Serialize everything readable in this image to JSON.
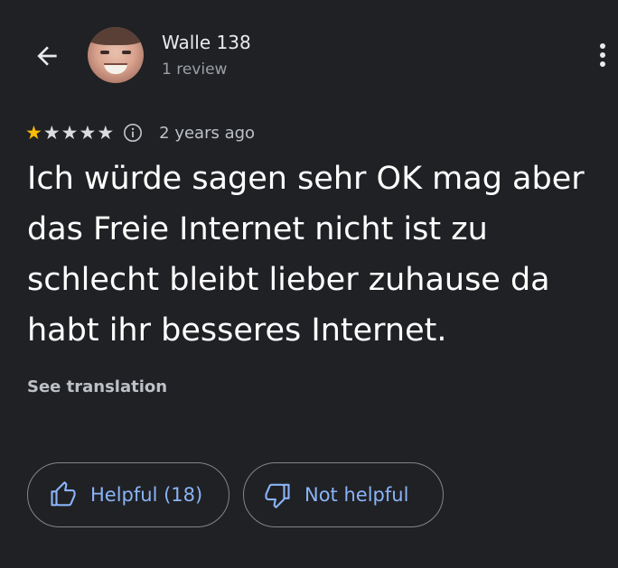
{
  "reviewer": {
    "name": "Walle 138",
    "review_count": "1 review"
  },
  "icons": {
    "back": "arrow-left-icon",
    "more": "more-vert-icon",
    "info": "info-icon",
    "thumb_up": "thumb-up-icon",
    "thumb_down": "thumb-down-icon"
  },
  "review": {
    "rating": 1,
    "max_rating": 5,
    "date": "2 years ago",
    "text": "Ich würde sagen sehr OK mag aber das Freie Internet nicht ist zu schlecht bleibt lieber zuhause da habt ihr besseres Internet.",
    "see_translation": "See translation"
  },
  "actions": {
    "helpful_label": "Helpful (18)",
    "not_helpful_label": "Not helpful"
  },
  "colors": {
    "background": "#202124",
    "star_filled": "#fbbc04",
    "star_empty": "#dadce0",
    "accent": "#8ab4f8",
    "outline": "#80868b"
  }
}
